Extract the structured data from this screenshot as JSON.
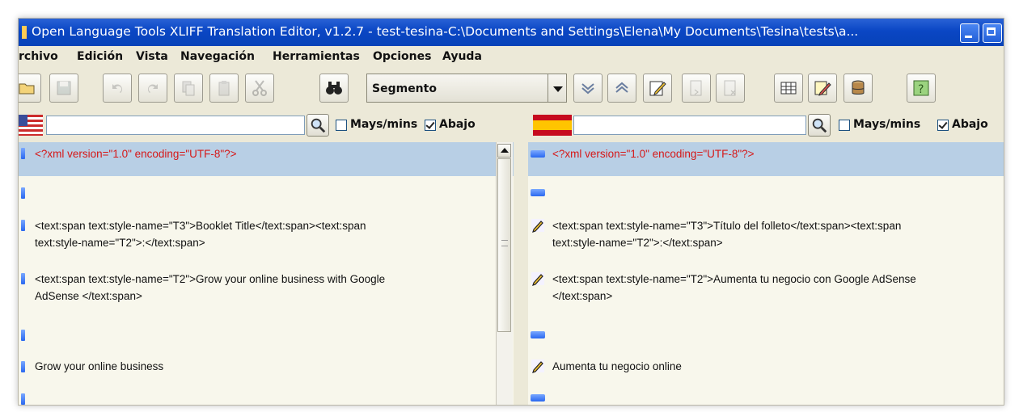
{
  "window": {
    "title": "Open Language Tools XLIFF Translation Editor, v1.2.7 - test-tesina-C:\\Documents and Settings\\Elena\\My Documents\\Tesina\\tests\\a..."
  },
  "menu": {
    "items": [
      "rchivo",
      "Edición",
      "Vista",
      "Navegación",
      "Herramientas",
      "Opciones",
      "Ayuda"
    ]
  },
  "toolbar": {
    "mode_select": "Segmento",
    "buttons": [
      "folder-icon",
      "save-icon",
      "undo-icon",
      "redo-icon",
      "copy-icon",
      "paste-icon",
      "cut-icon",
      "find-icon",
      "next-icon",
      "previous-icon",
      "edit-note-icon",
      "copy-source-icon",
      "clear-target-icon",
      "table-icon",
      "notes-icon",
      "database-icon",
      "help-icon"
    ]
  },
  "source": {
    "flag": "us-flag",
    "search_value": "",
    "case_label": "Mays/mins",
    "case_checked": false,
    "down_label": "Abajo",
    "down_checked": true,
    "segments": [
      {
        "lines": [
          "<?xml version=\"1.0\" encoding=\"UTF-8\"?>"
        ],
        "selected": true
      },
      {
        "lines": [
          ""
        ]
      },
      {
        "lines": [
          "<text:span text:style-name=\"T3\">Booklet Title</text:span><text:span",
          "text:style-name=\"T2\">:</text:span>"
        ]
      },
      {
        "lines": [
          "<text:span text:style-name=\"T2\">Grow your online business with Google",
          "AdSense </text:span>"
        ]
      },
      {
        "lines": [
          ""
        ]
      },
      {
        "lines": [
          "Grow your online business"
        ]
      },
      {
        "lines": [
          ""
        ]
      }
    ]
  },
  "target": {
    "flag": "es-flag",
    "search_value": "",
    "case_label": "Mays/mins",
    "case_checked": false,
    "down_label": "Abajo",
    "down_checked": true,
    "segments": [
      {
        "lines": [
          "<?xml version=\"1.0\" encoding=\"UTF-8\"?>"
        ],
        "selected": true
      },
      {
        "lines": [
          ""
        ]
      },
      {
        "lines": [
          "<text:span text:style-name=\"T3\">Título del folleto</text:span><text:span",
          "text:style-name=\"T2\">:</text:span>"
        ]
      },
      {
        "lines": [
          "<text:span text:style-name=\"T2\">Aumenta tu negocio con Google AdSense",
          "</text:span>"
        ]
      },
      {
        "lines": [
          ""
        ]
      },
      {
        "lines": [
          "Aumenta tu negocio online"
        ]
      },
      {
        "lines": [
          ""
        ]
      }
    ]
  },
  "colors": {
    "title_bar": "#0a46c4",
    "selected_row": "#b8cfe5",
    "tag_text": "#d61818",
    "background": "#ece9d8",
    "editor_bg": "#f8f7ec"
  }
}
